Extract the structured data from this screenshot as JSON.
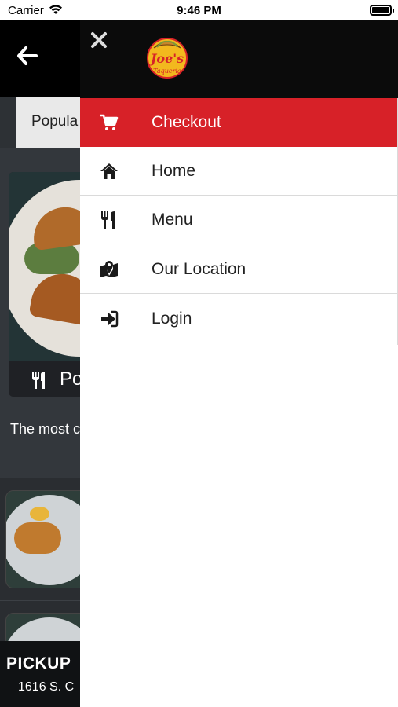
{
  "status_bar": {
    "carrier": "Carrier",
    "time": "9:46 PM"
  },
  "background": {
    "tab_popular": "Popula",
    "featured_label": "Po",
    "tagline": "The most c",
    "pickup_title": "PICKUP",
    "pickup_address": "1616 S. C"
  },
  "drawer": {
    "logo_text": "Joe's Taqueria",
    "items": [
      {
        "label": "Checkout",
        "icon": "cart-icon",
        "active": true
      },
      {
        "label": "Home",
        "icon": "home-icon",
        "active": false
      },
      {
        "label": "Menu",
        "icon": "utensils-icon",
        "active": false
      },
      {
        "label": "Our Location",
        "icon": "map-location-icon",
        "active": false
      },
      {
        "label": "Login",
        "icon": "sign-in-icon",
        "active": false
      }
    ]
  },
  "colors": {
    "accent_red": "#d72128",
    "header_black": "#0b0b0b",
    "background_dark": "#33373c"
  }
}
